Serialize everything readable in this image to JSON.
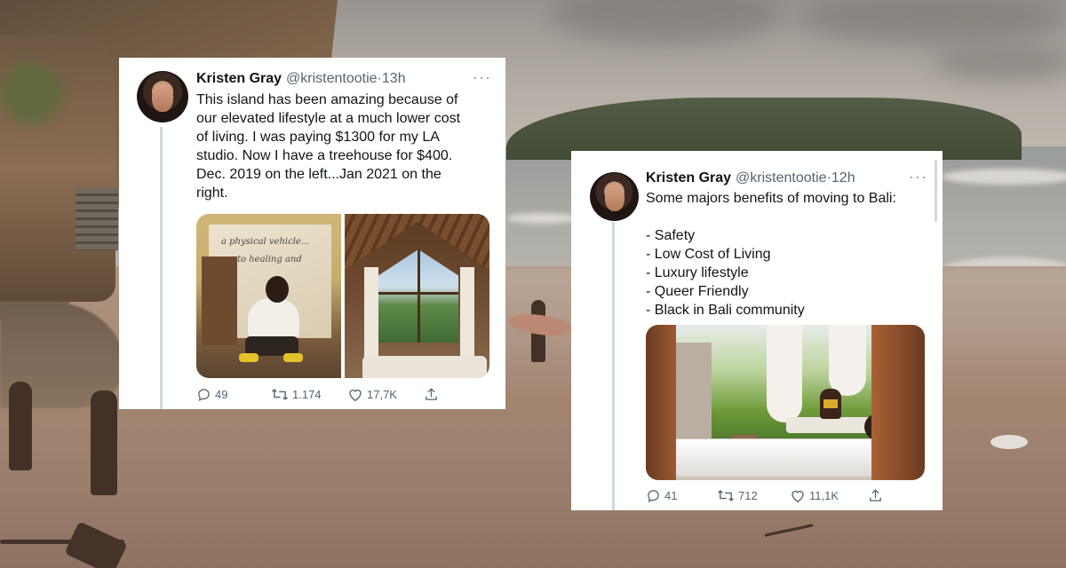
{
  "tweets": [
    {
      "name": "Kristen Gray",
      "handle": "@kristentootie",
      "separator": "·",
      "time": "13h",
      "more": "···",
      "text_lines": [
        "This island has been amazing because of",
        "our elevated lifestyle at a much lower cost",
        "of living. I was paying $1300 for my LA",
        "studio. Now I have a treehouse for $400.",
        "Dec. 2019 on the left...Jan 2021 on the",
        "right."
      ],
      "mirror_writing": [
        "a physical vehicle...",
        "to healing and"
      ],
      "replies": "49",
      "retweets": "1.174",
      "likes": "17,7K"
    },
    {
      "name": "Kristen Gray",
      "handle": "@kristentootie",
      "separator": "·",
      "time": "12h",
      "more": "···",
      "text_lines": [
        "Some majors benefits of moving to Bali:",
        "",
        "- Safety",
        "- Low Cost of Living",
        "- Luxury lifestyle",
        "- Queer Friendly",
        "- Black in Bali community"
      ],
      "replies": "41",
      "retweets": "712",
      "likes": "11,1K"
    }
  ],
  "icons": {
    "reply": "reply-icon",
    "retweet": "retweet-icon",
    "like": "heart-icon",
    "share": "share-icon",
    "more": "more-icon"
  },
  "colors": {
    "text_primary": "#0f1419",
    "text_secondary": "#536471",
    "thread_line": "#cfd9de",
    "card_bg": "#ffffff"
  }
}
